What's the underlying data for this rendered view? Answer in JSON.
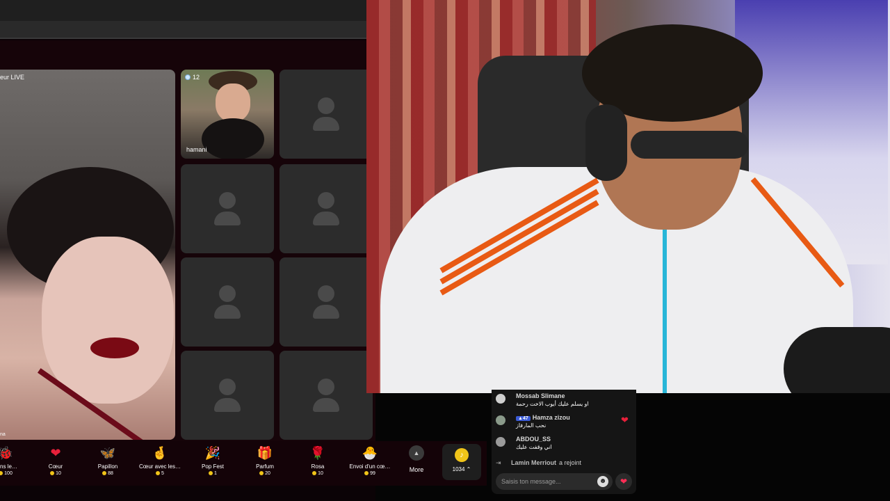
{
  "live": {
    "live_tag": "eur LIVE",
    "corner_label": "na"
  },
  "guests": [
    {
      "viewer_count": "12",
      "name": "hamani"
    }
  ],
  "gifts": [
    {
      "icon": "🐞",
      "name": "dans le…",
      "price": "100"
    },
    {
      "icon": "❤",
      "name": "Cœur",
      "price": "10"
    },
    {
      "icon": "🦋",
      "name": "Papillon",
      "price": "88"
    },
    {
      "icon": "🤞",
      "name": "Cœur avec les…",
      "price": "5"
    },
    {
      "icon": "🎉",
      "name": "Pop Fest",
      "price": "1"
    },
    {
      "icon": "🎁",
      "name": "Parfum",
      "price": "20"
    },
    {
      "icon": "🌹",
      "name": "Rosa",
      "price": "10"
    },
    {
      "icon": "🐣",
      "name": "Envoi d'un cœ…",
      "price": "99"
    }
  ],
  "more_label": "More",
  "coin_balance": "1034",
  "chat": {
    "messages": [
      {
        "user": "Mossab Slimane",
        "badge": "",
        "text": "او يسلم عليك أيوب الاخت رحمة"
      },
      {
        "user": "Hamza zizou",
        "badge": "47",
        "text": "نحب المارفاز"
      },
      {
        "user": "ABDOU_SS",
        "badge": "",
        "text": "اني وقفت عليك"
      }
    ],
    "join_user": "Lamin Merriout",
    "join_text": "a rejoint",
    "input_placeholder": "Saisis ton message..."
  }
}
